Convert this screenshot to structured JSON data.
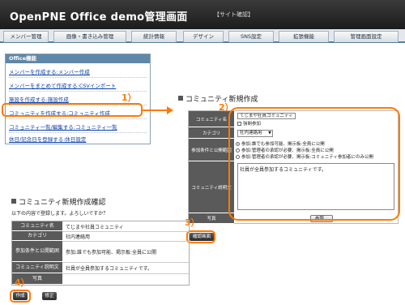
{
  "header": {
    "title": "OpenPNE Office demo管理画面",
    "site_link": "【サイト確認】"
  },
  "nav": {
    "tabs": [
      "メンバー管理",
      "画像・書き込み管理",
      "統計情報",
      "デザイン",
      "SNS設定",
      "拡張機能",
      "管理画面設定"
    ]
  },
  "sidebar": {
    "title": "Office機能",
    "items": [
      "メンバーを作成する:メンバー作成",
      "メンバーをまとめて作成する:CSVインポート",
      "施設を作成する:施設作成",
      "コミュニティを作成する:コミュニティ作成",
      "コミュニティ一覧/編集する:コミュニティ一覧",
      "休日/記念日を登録する:休日設定"
    ]
  },
  "steps": {
    "s1": "1）",
    "s2": "2）",
    "s3": "3）",
    "s4": "4）"
  },
  "create_form": {
    "title": "コミュニティ新規作成",
    "labels": {
      "name": "コミュニティ名",
      "category": "カテゴリ",
      "join": "参加条件と公開範囲",
      "description": "コミュニティ説明文",
      "photo": "写真"
    },
    "name_value": "てじまや社員コミュニティ",
    "force_join_label": "強制参加",
    "category_value": "社内連絡用",
    "join_options": [
      "参加:誰でも参加可能、掲示板:全員に公開",
      "参加:管理者の承認が必要、掲示板:全員に公開",
      "参加:管理者の承認が必要、掲示板:コミュニティ参加者にのみ公開"
    ],
    "description_value": "社員が全員参加するコミュニティです。",
    "browse_button": "参照...",
    "confirm_button": "確認画面"
  },
  "confirm": {
    "title": "コミュニティ新規作成確認",
    "description": "以下の内容で登録します。よろしいですか？",
    "rows": [
      {
        "label": "コミュニティ名",
        "value": "てじまや社員コミュニティ"
      },
      {
        "label": "カテゴリ",
        "value": "社内連絡用"
      },
      {
        "label": "参加条件と公開範囲",
        "value": "参加:誰でも参加可能、掲示板:全員に公開"
      },
      {
        "label": "コミュニティ説明文",
        "value": "社員が全員参加するコミュニティです。"
      },
      {
        "label": "写真",
        "value": ""
      }
    ],
    "submit_button": "作成",
    "back_button": "修正"
  },
  "colors": {
    "accent": "#ff7a00",
    "header_bg": "#2a2a2a",
    "label_bg": "#5a5a5a",
    "link": "#0b3ea8"
  }
}
